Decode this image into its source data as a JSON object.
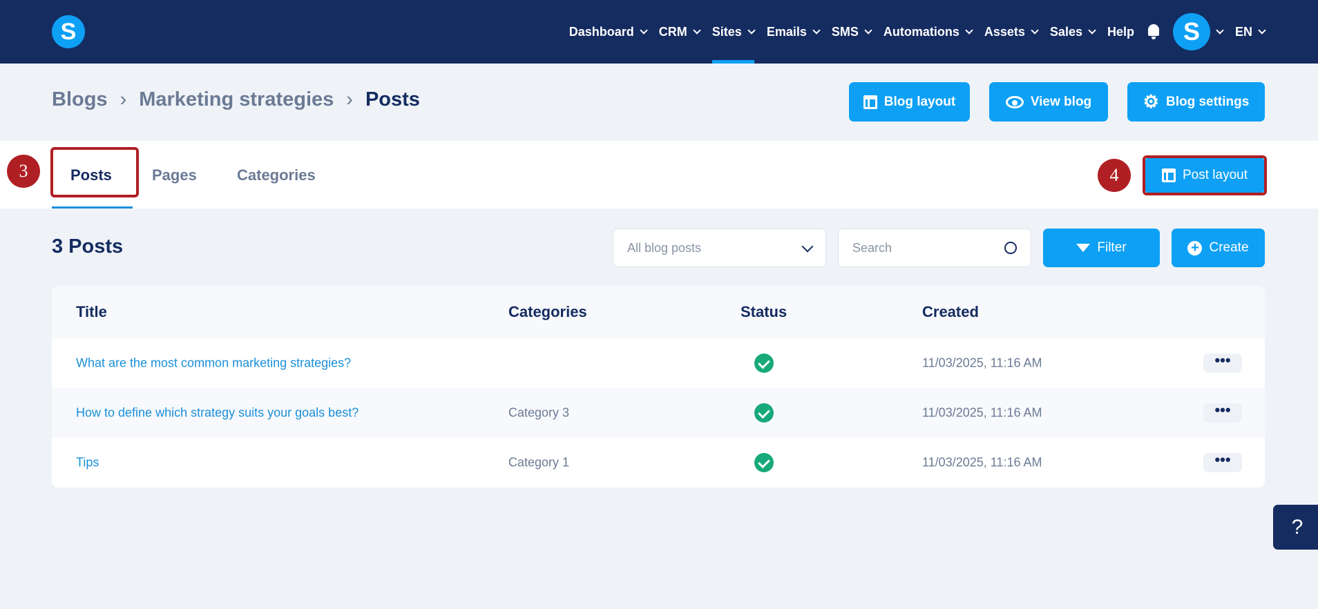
{
  "header": {
    "logo": "S",
    "nav": [
      {
        "label": "Dashboard",
        "dropdown": true
      },
      {
        "label": "CRM",
        "dropdown": true
      },
      {
        "label": "Sites",
        "dropdown": true,
        "active": true
      },
      {
        "label": "Emails",
        "dropdown": true
      },
      {
        "label": "SMS",
        "dropdown": true
      },
      {
        "label": "Automations",
        "dropdown": true
      },
      {
        "label": "Assets",
        "dropdown": true
      },
      {
        "label": "Sales",
        "dropdown": true
      },
      {
        "label": "Help",
        "dropdown": false
      }
    ],
    "avatar": "S",
    "language": "EN"
  },
  "breadcrumb": [
    "Blogs",
    "Marketing strategies",
    "Posts"
  ],
  "actions": {
    "blog_layout": "Blog layout",
    "view_blog": "View blog",
    "blog_settings": "Blog settings"
  },
  "tabs": [
    "Posts",
    "Pages",
    "Categories"
  ],
  "post_layout": "Post layout",
  "annotations": {
    "tabs": "3",
    "post_layout": "4"
  },
  "list": {
    "count_label": "3 Posts",
    "filter_select": "All blog posts",
    "search_placeholder": "Search",
    "filter": "Filter",
    "create": "Create"
  },
  "table": {
    "columns": [
      "Title",
      "Categories",
      "Status",
      "Created"
    ],
    "rows": [
      {
        "title": "What are the most common marketing strategies?",
        "category": "",
        "status": "published",
        "created": "11/03/2025, 11:16 AM"
      },
      {
        "title": "How to define which strategy suits your goals best?",
        "category": "Category 3",
        "status": "published",
        "created": "11/03/2025, 11:16 AM"
      },
      {
        "title": "Tips",
        "category": "Category 1",
        "status": "published",
        "created": "11/03/2025, 11:16 AM"
      }
    ]
  },
  "help": "?",
  "colors": {
    "navy": "#152c61",
    "accent": "#0ea0f5",
    "annotation": "#b01f24",
    "success": "#17a97a"
  }
}
